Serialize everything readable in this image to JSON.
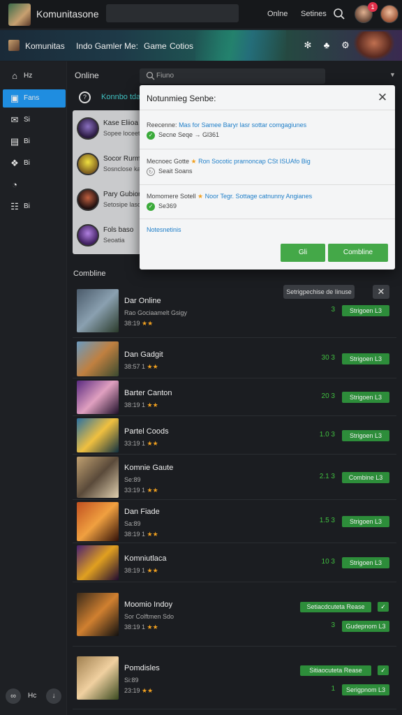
{
  "topbar": {
    "brand": "Komunitasone",
    "online_label": "Onlne",
    "settings_label": "Setines",
    "notification_count": "1"
  },
  "banner": {
    "brand": "Komunitas",
    "links": [
      "Indo Gamler",
      "Me:",
      "Game",
      "Cotios"
    ]
  },
  "sidebar": {
    "items": [
      {
        "icon": "home-icon",
        "label": "Hz",
        "active": false
      },
      {
        "icon": "store-icon",
        "label": "Fans",
        "active": true
      },
      {
        "icon": "inbox-icon",
        "label": "Si",
        "active": false
      },
      {
        "icon": "library-icon",
        "label": "Bi",
        "active": false
      },
      {
        "icon": "controller-icon",
        "label": "Bi",
        "active": false
      },
      {
        "icon": "clock-icon",
        "label": "",
        "active": false
      },
      {
        "icon": "book-icon",
        "label": "Bi",
        "active": false
      }
    ],
    "footer_label": "Hc"
  },
  "main": {
    "title": "Online",
    "search_placeholder": "Fiuno",
    "community_label": "Konnbo tdaver",
    "section_title": "Combline"
  },
  "community_panel": [
    {
      "name": "Kase Eliioa",
      "sub": "Sopee loceet"
    },
    {
      "name": "Socor Rurm",
      "sub": "Sosnclose kaus"
    },
    {
      "name": "Pary Gubior",
      "sub": "Setosipe laso"
    },
    {
      "name": "Fols baso",
      "sub": "Seoatia"
    }
  ],
  "modal": {
    "title": "Notunmieg Senbe:",
    "items": [
      {
        "prefix": "Reecenne:",
        "accent": "Mas for Samee Baryr lasr sottar comgagiunes",
        "star": false,
        "status": "ok",
        "line2": "Secne Seqe → Gl361"
      },
      {
        "prefix": "Mecnoec Gotte",
        "accent": "Ron  Socotic prarnoncap CSt ISUAfo Big",
        "star": true,
        "status": "pending",
        "line2": "Seait Soans"
      },
      {
        "prefix": "Momomere Sotell",
        "accent": "Noor Tegr. Sottage catnunny Angianes",
        "star": true,
        "status": "ok",
        "line2": "Se369"
      }
    ],
    "link": "Notesnetinis",
    "ok_label": "Gli",
    "continue_label": "Combline"
  },
  "games": [
    {
      "name": "Dar Online",
      "desc": "Rao Gociaamelt Gsigy",
      "rating": "38:19",
      "count": "3",
      "play": "Strigoen  L3",
      "tag": "Setrigpechise de Iinuse",
      "thumb": [
        "#4a5a6a",
        "#8aa0b0",
        "#2a3a2a"
      ]
    },
    {
      "name": "Dan Gadgit",
      "desc": "",
      "rating": "38:57  1",
      "count": "30 3",
      "play": "Strigoen  L3",
      "thumb": [
        "#6a9ac0",
        "#c08040",
        "#3a4a30"
      ]
    },
    {
      "name": "Barter Canton",
      "desc": "",
      "rating": "38:19  1",
      "count": "20 3",
      "play": "Strigoen  L3",
      "thumb": [
        "#5a2a80",
        "#e0a0c0",
        "#20102a"
      ]
    },
    {
      "name": "Partel Coods",
      "desc": "",
      "rating": "33:19  1",
      "count": "1.0 3",
      "play": "Strigoen  L3",
      "thumb": [
        "#2a70a0",
        "#f0c040",
        "#103040"
      ]
    },
    {
      "name": "Komnie Gaute",
      "desc": "Se:89",
      "rating": "33:19  1",
      "count": "2.1 3",
      "play": "Combine  L3",
      "thumb": [
        "#c0a070",
        "#5a4a3a",
        "#e0d0b0"
      ]
    },
    {
      "name": "Dan Fiade",
      "desc": "Sa:89",
      "rating": "38:19  1",
      "count": "1.5 3",
      "play": "Strigoen  L3",
      "thumb": [
        "#c05020",
        "#f0a040",
        "#301008"
      ]
    },
    {
      "name": "Komniutlaca",
      "desc": "",
      "rating": "38:19  1",
      "count": "10 3",
      "play": "Strigoen  L3",
      "thumb": [
        "#4a2070",
        "#e0a020",
        "#200a30"
      ]
    },
    {
      "name": "Moomio Indoy",
      "desc": "Sor Colftmen Sdo",
      "rating": "38:19  1",
      "count": "3",
      "play": "Gudepnom  L3",
      "badge": "Setiacdcuteta Rease",
      "thumb": [
        "#3a2a1a",
        "#d08030",
        "#101010"
      ]
    },
    {
      "name": "Pomdisles",
      "desc": "Si:89",
      "rating": "23:19",
      "count": "1",
      "play": "Serigpnom  L3",
      "badge": "Sitiaocuteta Rease",
      "thumb": [
        "#a08050",
        "#f0d0a0",
        "#3a4a20"
      ]
    }
  ]
}
